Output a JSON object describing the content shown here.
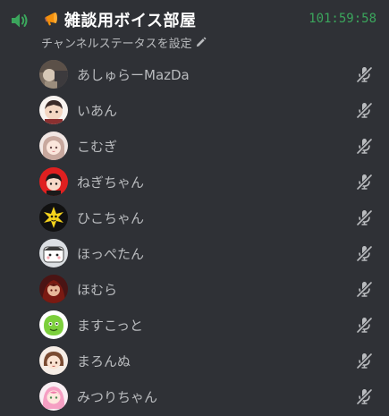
{
  "channel": {
    "name": "雑談用ボイス部屋",
    "emoji": "megaphone-icon",
    "timer": "101:59:58",
    "status_label": "チャンネルステータスを設定"
  },
  "colors": {
    "background": "#2f3136",
    "timer": "#3ba55c",
    "speaker": "#3ba55c",
    "member_text": "#b9bbbe",
    "mute_icon": "#b9bbbe"
  },
  "members": [
    {
      "name": "あしゅらーMazDa",
      "avatar": "photo-avatar",
      "muted": true
    },
    {
      "name": "いあん",
      "avatar": "character-avatar",
      "muted": true
    },
    {
      "name": "こむぎ",
      "avatar": "character-avatar",
      "muted": true
    },
    {
      "name": "ねぎちゃん",
      "avatar": "character-avatar",
      "muted": true
    },
    {
      "name": "ひこちゃん",
      "avatar": "character-avatar",
      "muted": true
    },
    {
      "name": "ほっぺたん",
      "avatar": "character-avatar",
      "muted": true
    },
    {
      "name": "ほむら",
      "avatar": "character-avatar",
      "muted": true
    },
    {
      "name": "ますこっと",
      "avatar": "character-avatar",
      "muted": true
    },
    {
      "name": "まろんぬ",
      "avatar": "character-avatar",
      "muted": true
    },
    {
      "name": "みつりちゃん",
      "avatar": "character-avatar",
      "muted": true
    }
  ]
}
